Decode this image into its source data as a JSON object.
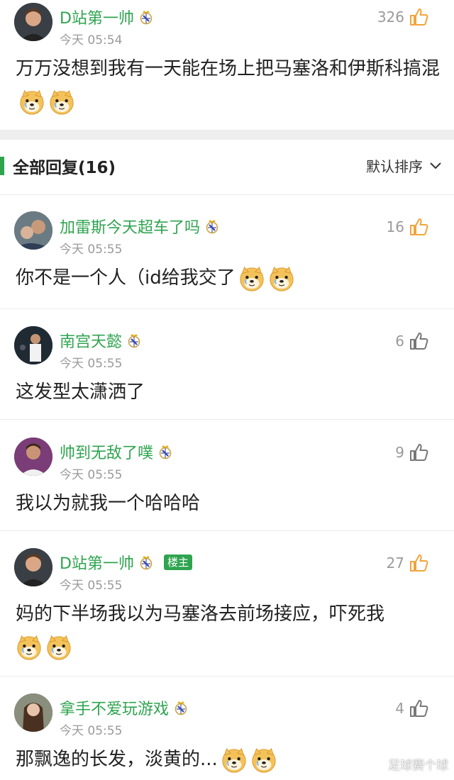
{
  "top_comment": {
    "username": "D站第一帅",
    "time": "今天 05:54",
    "likes": "326",
    "text": "万万没想到我有一天能在场上把马塞洛和伊斯科搞混"
  },
  "replies_header": {
    "title": "全部回复(16)",
    "sort_label": "默认排序"
  },
  "replies": [
    {
      "username": "加雷斯今天超车了吗",
      "time": "今天 05:55",
      "likes": "16",
      "text": "你不是一个人（id给我交了",
      "owner_badge": ""
    },
    {
      "username": "南宫天懿",
      "time": "今天 05:55",
      "likes": "6",
      "text": "这发型太潇洒了",
      "owner_badge": ""
    },
    {
      "username": "帅到无敌了噗",
      "time": "今天 05:55",
      "likes": "9",
      "text": "我以为就我一个哈哈哈",
      "owner_badge": ""
    },
    {
      "username": "D站第一帅",
      "time": "今天 05:55",
      "likes": "27",
      "text": "妈的下半场我以为马塞洛去前场接应，吓死我",
      "owner_badge": "楼主"
    },
    {
      "username": "拿手不爱玩游戏",
      "time": "今天 05:55",
      "likes": "4",
      "text": "那飘逸的长发，淡黄的...",
      "owner_badge": ""
    }
  ],
  "watermark": "足球赛个球",
  "colors": {
    "accent": "#2ea44f",
    "like_active": "#f2a33a",
    "like_inactive": "#777777"
  }
}
